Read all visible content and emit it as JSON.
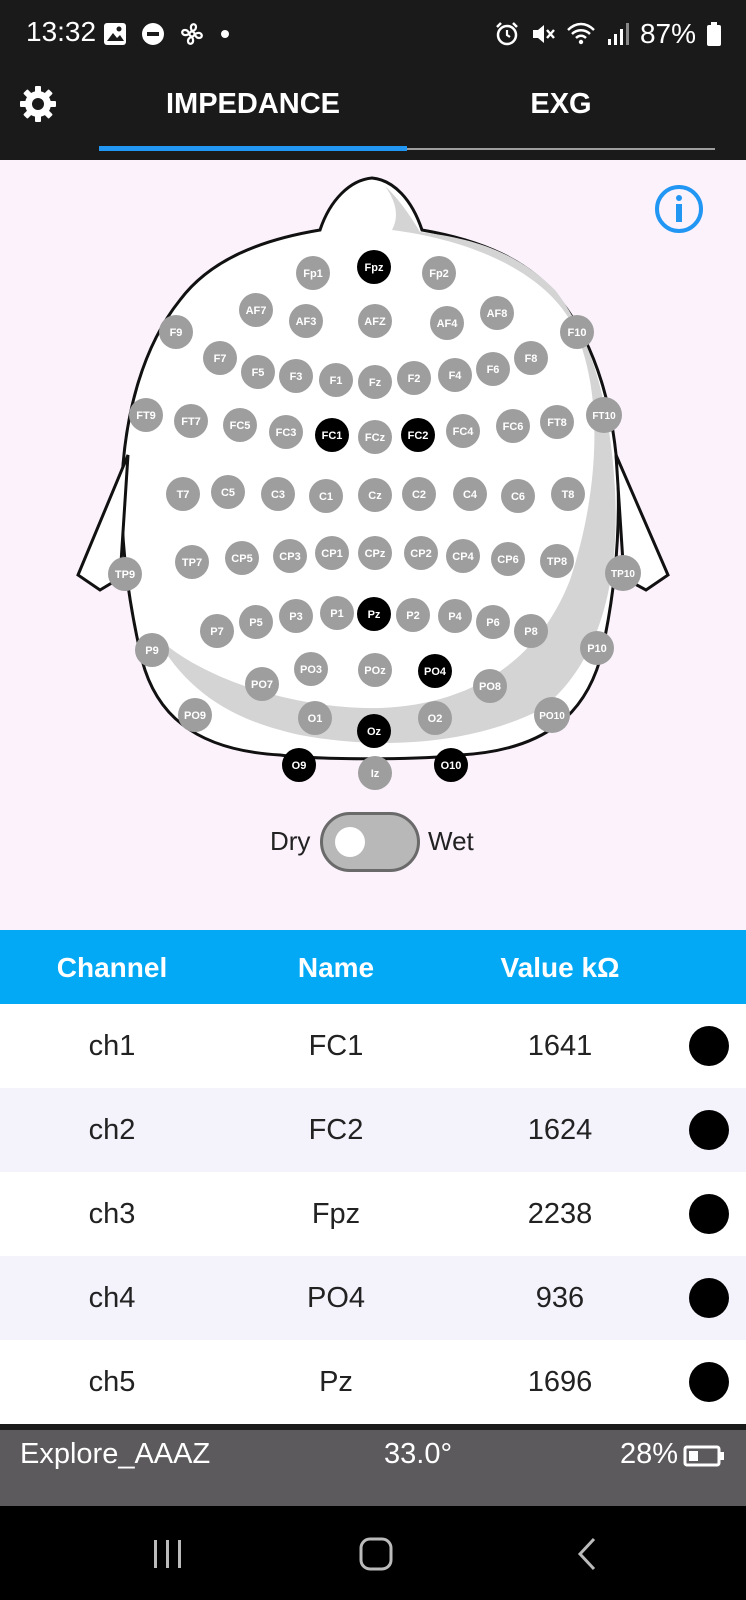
{
  "status_bar": {
    "time": "13:32",
    "battery_text": "87%",
    "left_icons": [
      "gallery-icon",
      "do-not-disturb-icon",
      "fan-icon",
      "dot-icon"
    ],
    "right_icons": [
      "alarm-icon",
      "mute-icon",
      "wifi-icon",
      "signal-icon",
      "battery-icon"
    ]
  },
  "app_bar": {
    "settings_icon": "gear-icon",
    "tabs": [
      {
        "label": "IMPEDANCE",
        "selected": true
      },
      {
        "label": "EXG",
        "selected": false
      }
    ],
    "accent_color": "#2196f3"
  },
  "head_map": {
    "info_icon": "info-icon",
    "electrodes": [
      {
        "label": "Fpz",
        "active": true
      },
      {
        "label": "Fp1",
        "active": false
      },
      {
        "label": "Fp2",
        "active": false
      },
      {
        "label": "AF7",
        "active": false
      },
      {
        "label": "AF3",
        "active": false
      },
      {
        "label": "AFZ",
        "active": false
      },
      {
        "label": "AF4",
        "active": false
      },
      {
        "label": "AF8",
        "active": false
      },
      {
        "label": "F9",
        "active": false
      },
      {
        "label": "F10",
        "active": false
      },
      {
        "label": "F7",
        "active": false
      },
      {
        "label": "F5",
        "active": false
      },
      {
        "label": "F3",
        "active": false
      },
      {
        "label": "F1",
        "active": false
      },
      {
        "label": "Fz",
        "active": false
      },
      {
        "label": "F2",
        "active": false
      },
      {
        "label": "F4",
        "active": false
      },
      {
        "label": "F6",
        "active": false
      },
      {
        "label": "F8",
        "active": false
      },
      {
        "label": "FT9",
        "active": false
      },
      {
        "label": "FT7",
        "active": false
      },
      {
        "label": "FC5",
        "active": false
      },
      {
        "label": "FC3",
        "active": false
      },
      {
        "label": "FC1",
        "active": true
      },
      {
        "label": "FCz",
        "active": false
      },
      {
        "label": "FC2",
        "active": true
      },
      {
        "label": "FC4",
        "active": false
      },
      {
        "label": "FC6",
        "active": false
      },
      {
        "label": "FT8",
        "active": false
      },
      {
        "label": "FT10",
        "active": false
      },
      {
        "label": "T7",
        "active": false
      },
      {
        "label": "C5",
        "active": false
      },
      {
        "label": "C3",
        "active": false
      },
      {
        "label": "C1",
        "active": false
      },
      {
        "label": "Cz",
        "active": false
      },
      {
        "label": "C2",
        "active": false
      },
      {
        "label": "C4",
        "active": false
      },
      {
        "label": "C6",
        "active": false
      },
      {
        "label": "T8",
        "active": false
      },
      {
        "label": "TP9",
        "active": false
      },
      {
        "label": "TP7",
        "active": false
      },
      {
        "label": "CP5",
        "active": false
      },
      {
        "label": "CP3",
        "active": false
      },
      {
        "label": "CP1",
        "active": false
      },
      {
        "label": "CPz",
        "active": false
      },
      {
        "label": "CP2",
        "active": false
      },
      {
        "label": "CP4",
        "active": false
      },
      {
        "label": "CP6",
        "active": false
      },
      {
        "label": "TP8",
        "active": false
      },
      {
        "label": "TP10",
        "active": false
      },
      {
        "label": "P9",
        "active": false
      },
      {
        "label": "P7",
        "active": false
      },
      {
        "label": "P5",
        "active": false
      },
      {
        "label": "P3",
        "active": false
      },
      {
        "label": "P1",
        "active": false
      },
      {
        "label": "Pz",
        "active": true
      },
      {
        "label": "P2",
        "active": false
      },
      {
        "label": "P4",
        "active": false
      },
      {
        "label": "P6",
        "active": false
      },
      {
        "label": "P8",
        "active": false
      },
      {
        "label": "P10",
        "active": false
      },
      {
        "label": "PO7",
        "active": false
      },
      {
        "label": "PO3",
        "active": false
      },
      {
        "label": "POz",
        "active": false
      },
      {
        "label": "PO4",
        "active": true
      },
      {
        "label": "PO8",
        "active": false
      },
      {
        "label": "PO9",
        "active": false
      },
      {
        "label": "O1",
        "active": false
      },
      {
        "label": "Oz",
        "active": true
      },
      {
        "label": "O2",
        "active": false
      },
      {
        "label": "PO10",
        "active": false
      },
      {
        "label": "O9",
        "active": true
      },
      {
        "label": "Iz",
        "active": false
      },
      {
        "label": "O10",
        "active": true
      }
    ]
  },
  "toggle": {
    "left_label": "Dry",
    "right_label": "Wet",
    "state": "Dry"
  },
  "table": {
    "headers": {
      "channel": "Channel",
      "name": "Name",
      "value": "Value kΩ"
    },
    "rows": [
      {
        "channel": "ch1",
        "name": "FC1",
        "value": "1641"
      },
      {
        "channel": "ch2",
        "name": "FC2",
        "value": "1624"
      },
      {
        "channel": "ch3",
        "name": "Fpz",
        "value": "2238"
      },
      {
        "channel": "ch4",
        "name": "PO4",
        "value": "936"
      },
      {
        "channel": "ch5",
        "name": "Pz",
        "value": "1696"
      }
    ],
    "header_color": "#03a9f4"
  },
  "device_bar": {
    "device_name": "Explore_AAAZ",
    "temperature": "33.0°",
    "battery": "28%"
  },
  "nav_bar": {
    "buttons": [
      "recents-icon",
      "home-icon",
      "back-icon"
    ]
  }
}
